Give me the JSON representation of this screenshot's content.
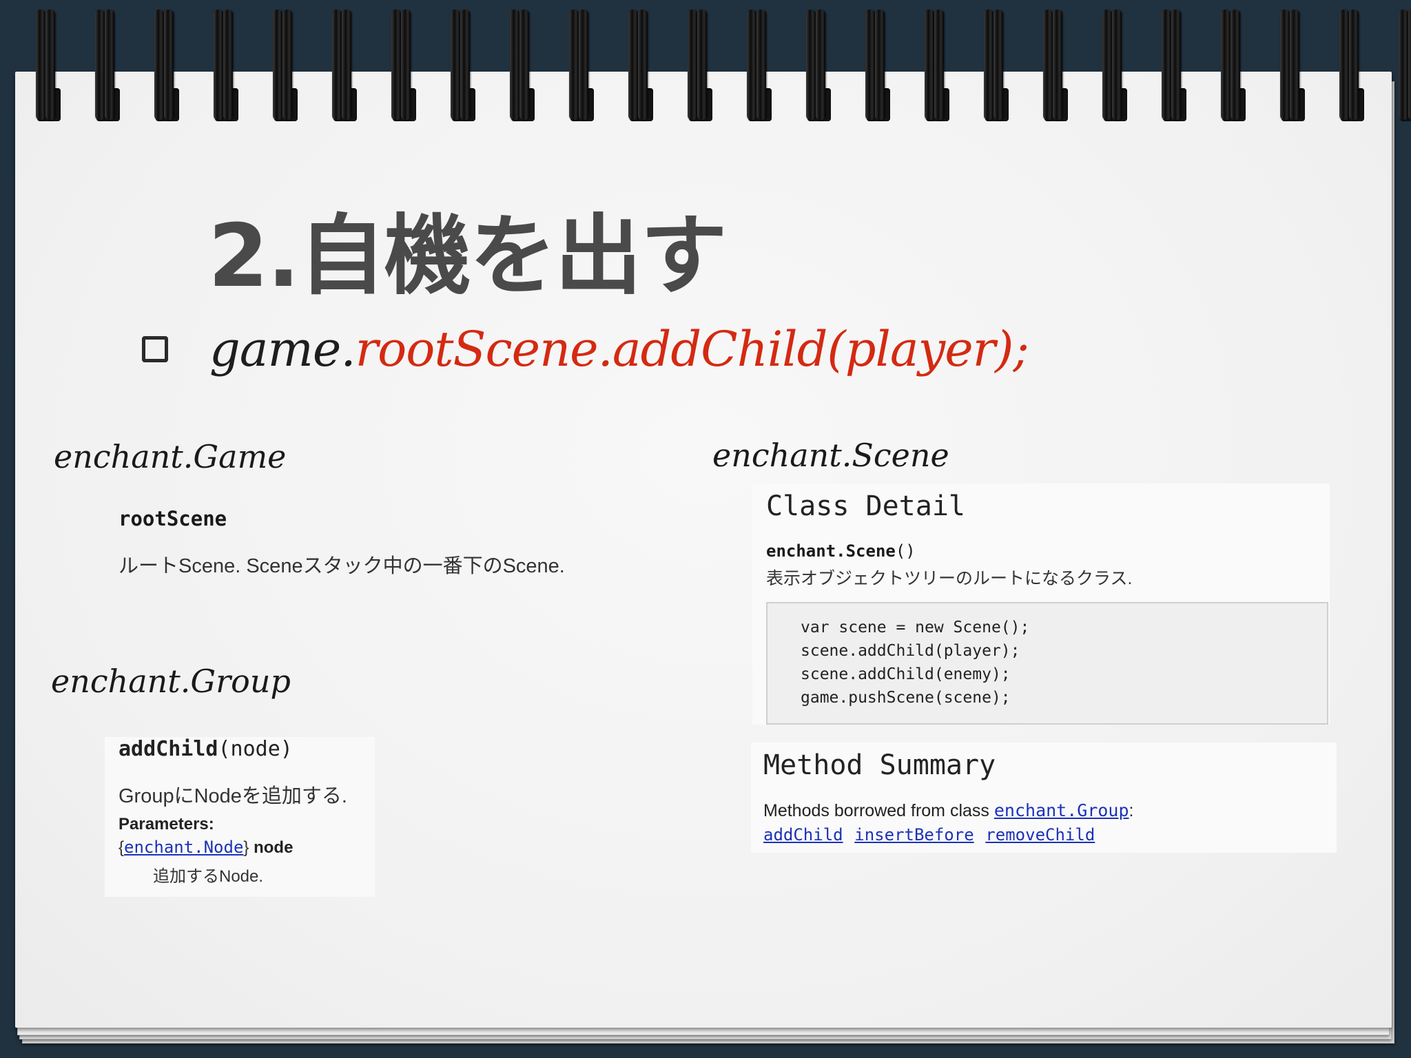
{
  "slide": {
    "title": "2.自機を出す",
    "bullet": {
      "code_plain": "game.",
      "code_highlight": "rootScene.addChild(player);"
    }
  },
  "labels": {
    "game": "enchant.Game",
    "group": "enchant.Group",
    "scene": "enchant.Scene"
  },
  "game_doc": {
    "property_name": "rootScene",
    "property_desc": "ルートScene. Sceneスタック中の一番下のScene."
  },
  "group_doc": {
    "method_name": "addChild",
    "method_args": "(node)",
    "method_desc": "GroupにNodeを追加する.",
    "params_label": "Parameters:",
    "param_brace_open": "{",
    "param_type": "enchant.Node",
    "param_brace_close": "}",
    "param_name": "node",
    "param_desc": "追加するNode."
  },
  "scene_doc": {
    "heading": "Class Detail",
    "ctor_name": "enchant.Scene",
    "ctor_parens": "()",
    "ctor_desc": "表示オブジェクトツリーのルートになるクラス.",
    "code_lines": [
      "var scene = new Scene();",
      "scene.addChild(player);",
      "scene.addChild(enemy);",
      "game.pushScene(scene);"
    ]
  },
  "method_summary": {
    "heading": "Method Summary",
    "borrowed_text": "Methods borrowed from class ",
    "borrowed_class": "enchant.Group",
    "borrowed_colon": ":",
    "methods": [
      "addChild",
      "insertBefore",
      "removeChild"
    ]
  },
  "colors": {
    "title": "#4a4a4a",
    "code_highlight": "#d42a12",
    "link": "#1c32b8",
    "background": "#20313f",
    "paper": "#f4f4f4"
  }
}
